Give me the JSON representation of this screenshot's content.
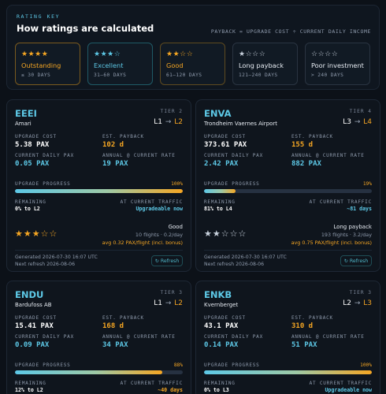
{
  "key": {
    "eyebrow": "RATING KEY",
    "title": "How ratings are calculated",
    "formula": "PAYBACK = UPGRADE COST ÷ CURRENT DAILY INCOME",
    "tiers": [
      {
        "stars": "★★★★",
        "name": "Outstanding",
        "range": "≤ 30 DAYS",
        "color": "#f5a623",
        "filled": 4
      },
      {
        "stars": "★★★☆",
        "name": "Excellent",
        "range": "31–60 DAYS",
        "color": "#5dc8e6",
        "filled": 3
      },
      {
        "stars": "★★☆☆",
        "name": "Good",
        "range": "61–120 DAYS",
        "color": "#f5a623",
        "filled": 2
      },
      {
        "stars": "★☆☆☆",
        "name": "Long payback",
        "range": "121–240 DAYS",
        "color": "#c9d2de",
        "filled": 1
      },
      {
        "stars": "☆☆☆☆",
        "name": "Poor investment",
        "range": "> 240 DAYS",
        "color": "#c9d2de",
        "filled": 0
      }
    ]
  },
  "labels": {
    "upgrade_cost": "UPGRADE COST",
    "est_payback": "EST. PAYBACK",
    "daily_pax": "CURRENT DAILY PAX",
    "annual": "ANNUAL @ CURRENT RATE",
    "progress": "UPGRADE PROGRESS",
    "remaining": "REMAINING",
    "at_traffic": "AT CURRENT TRAFFIC",
    "refresh": "Refresh"
  },
  "cards": [
    {
      "code": "EEEI",
      "name": "Amari",
      "tier": "TIER 2",
      "from": "L1",
      "to": "L2",
      "upgrade_cost": "5.38 PAX",
      "payback": "102 d",
      "daily_pax": "0.05 PAX",
      "annual": "19 PAX",
      "progress_label": "100%",
      "progress": 1.0,
      "remaining": "0% to L2",
      "traffic": "Upgradeable now",
      "stars": "★★★☆☆",
      "star_color": "#f5a623",
      "rating": "Good",
      "flights": "10 flights · 0.2/day",
      "avg": "avg 0.32 PAX/flight (incl. bonus)",
      "generated": "Generated 2026-07-30 16:07 UTC",
      "next": "Next refresh 2026-08-06"
    },
    {
      "code": "ENVA",
      "name": "Trondheim Vaernes Airport",
      "tier": "TIER 4",
      "from": "L3",
      "to": "L4",
      "upgrade_cost": "373.61 PAX",
      "payback": "155 d",
      "daily_pax": "2.42 PAX",
      "annual": "882 PAX",
      "progress_label": "19%",
      "progress": 0.19,
      "remaining": "81% to L4",
      "traffic": "~81 days",
      "stars": "★★☆☆☆",
      "star_color": "#c9d2de",
      "rating": "Long payback",
      "flights": "193 flights · 3.2/day",
      "avg": "avg 0.75 PAX/flight (incl. bonus)",
      "generated": "Generated 2026-07-30 16:07 UTC",
      "next": "Next refresh 2026-08-06"
    },
    {
      "code": "ENDU",
      "name": "Bardufoss AB",
      "tier": "TIER 3",
      "from": "L1",
      "to": "L2",
      "upgrade_cost": "15.41 PAX",
      "payback": "168 d",
      "daily_pax": "0.09 PAX",
      "annual": "34 PAX",
      "progress_label": "88%",
      "progress": 0.88,
      "remaining": "12% to L2",
      "traffic": "~40 days"
    },
    {
      "code": "ENKB",
      "name": "Kvernberget",
      "tier": "TIER 3",
      "from": "L2",
      "to": "L3",
      "upgrade_cost": "43.1 PAX",
      "payback": "310 d",
      "daily_pax": "0.14 PAX",
      "annual": "51 PAX",
      "progress_label": "100%",
      "progress": 1.0,
      "remaining": "0% to L3",
      "traffic": "Upgradeable now"
    }
  ]
}
